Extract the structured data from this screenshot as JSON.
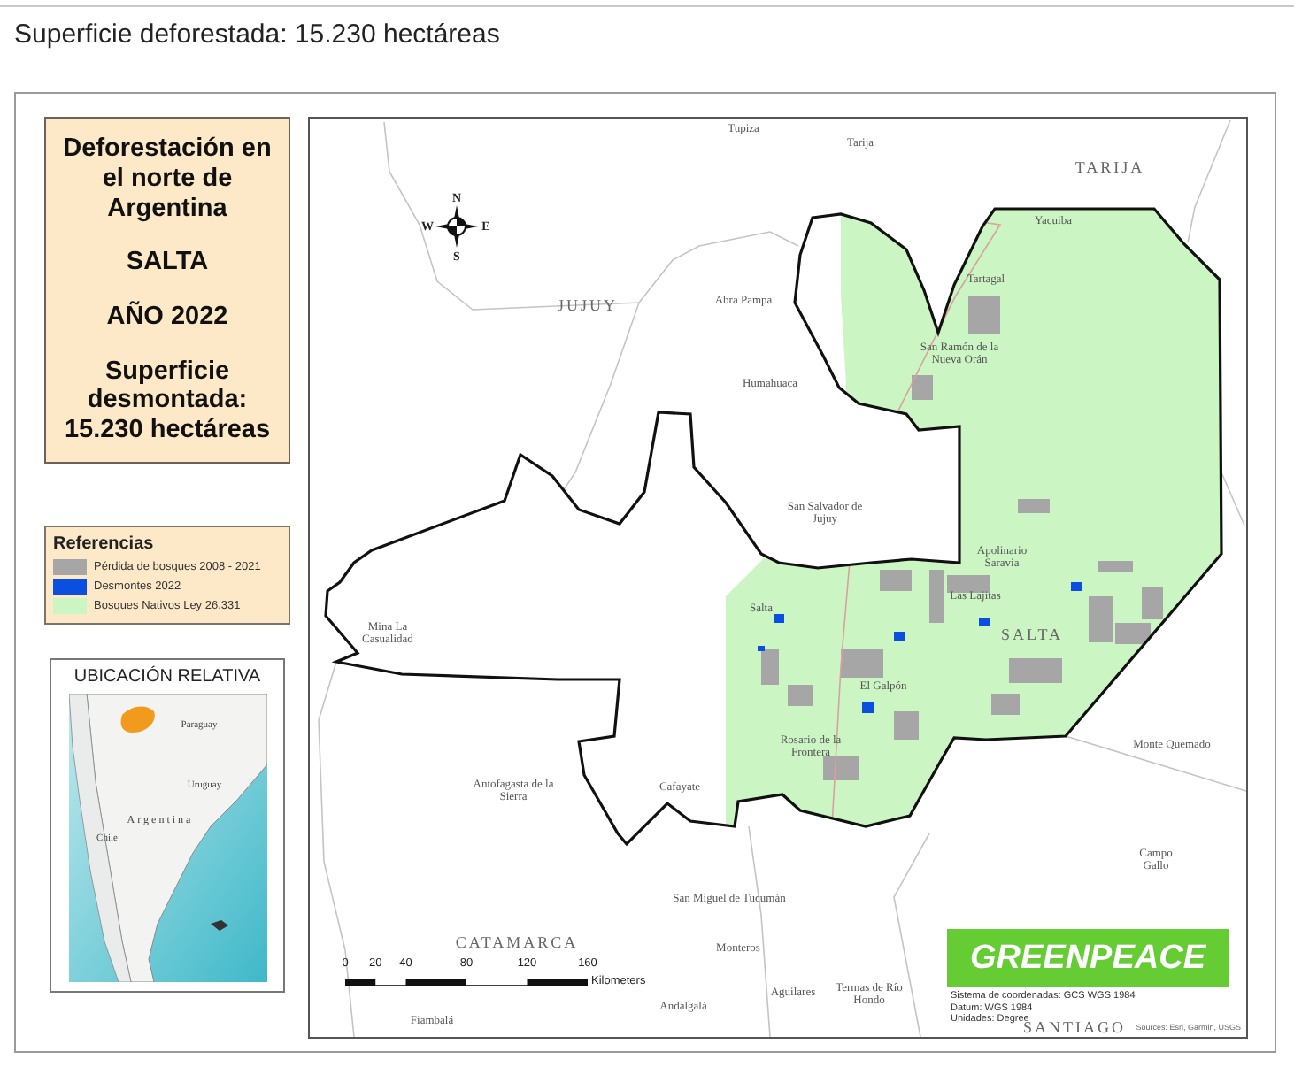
{
  "page_heading": "Superficie deforestada: 15.230 hectáreas",
  "title_box": {
    "lines": [
      "Deforestación en el norte de Argentina",
      "SALTA",
      "AÑO 2022",
      "Superficie desmontada: 15.230 hectáreas"
    ]
  },
  "legend": {
    "title": "Referencias",
    "items": [
      {
        "label": "Pérdida de bosques 2008 - 2021",
        "color": "#a6a6a6"
      },
      {
        "label": "Desmontes 2022",
        "color": "#0a4fe0"
      },
      {
        "label": "Bosques Nativos Ley 26.331",
        "color": "#ccf5c4"
      }
    ]
  },
  "inset": {
    "title": "UBICACIÓN RELATIVA",
    "labels": [
      "Paraguay",
      "Uruguay",
      "Chile",
      "Argentina"
    ]
  },
  "map": {
    "labels": [
      {
        "text": "Tupiza",
        "kind": "city"
      },
      {
        "text": "Tarija",
        "kind": "city"
      },
      {
        "text": "TARIJA",
        "kind": "region"
      },
      {
        "text": "JUJUY",
        "kind": "region"
      },
      {
        "text": "Abra Pampa",
        "kind": "city"
      },
      {
        "text": "Humahuaca",
        "kind": "city"
      },
      {
        "text": "San Salvador de Jujuy",
        "kind": "city"
      },
      {
        "text": "Yacuiba",
        "kind": "city"
      },
      {
        "text": "Tartagal",
        "kind": "city"
      },
      {
        "text": "San Ramón de la Nueva Orán",
        "kind": "city"
      },
      {
        "text": "Apolinario Saravia",
        "kind": "city"
      },
      {
        "text": "Las Lajitas",
        "kind": "city"
      },
      {
        "text": "SALTA",
        "kind": "region"
      },
      {
        "text": "Salta",
        "kind": "city"
      },
      {
        "text": "El Galpón",
        "kind": "city"
      },
      {
        "text": "Mina La Casualidad",
        "kind": "city"
      },
      {
        "text": "Rosario de la Frontera",
        "kind": "city"
      },
      {
        "text": "Cafayate",
        "kind": "city"
      },
      {
        "text": "Antofagasta de la Sierra",
        "kind": "city"
      },
      {
        "text": "Monte Quemado",
        "kind": "city"
      },
      {
        "text": "Campo Gallo",
        "kind": "city"
      },
      {
        "text": "San Miguel de Tucumán",
        "kind": "city"
      },
      {
        "text": "CATAMARCA",
        "kind": "region"
      },
      {
        "text": "Monteros",
        "kind": "city"
      },
      {
        "text": "Aguilares",
        "kind": "city"
      },
      {
        "text": "Andalgalá",
        "kind": "city"
      },
      {
        "text": "Fiambalá",
        "kind": "city"
      },
      {
        "text": "Termas de Río Hondo",
        "kind": "city"
      },
      {
        "text": "SANTIAGO",
        "kind": "region"
      }
    ],
    "compass": {
      "north": "N",
      "south": "S",
      "east": "E",
      "west": "W"
    },
    "scale_bar": {
      "ticks": [
        "0",
        "20",
        "40",
        "80",
        "120",
        "160"
      ],
      "unit": "Kilometers"
    },
    "logo": "GREENPEACE",
    "metadata": [
      "Sistema de coordenadas: GCS WGS 1984",
      "Datum: WGS 1984",
      "Unidades: Degree"
    ],
    "credits": "Sources: Esri, Garmin, USGS"
  }
}
